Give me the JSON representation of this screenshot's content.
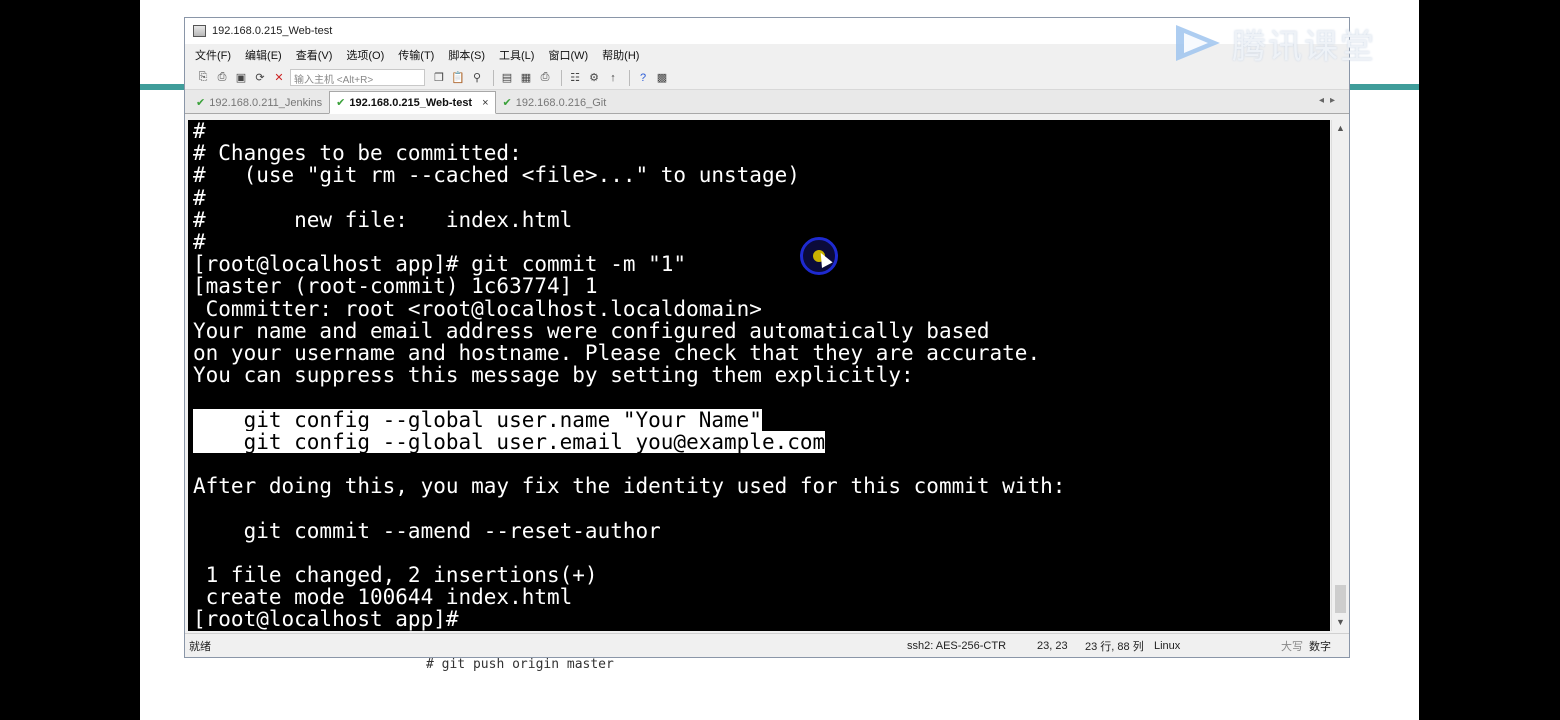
{
  "window": {
    "title": "192.168.0.215_Web-test"
  },
  "menu": [
    "文件(F)",
    "编辑(E)",
    "查看(V)",
    "选项(O)",
    "传输(T)",
    "脚本(S)",
    "工具(L)",
    "窗口(W)",
    "帮助(H)"
  ],
  "toolbar": {
    "host_placeholder": "输入主机 <Alt+R>"
  },
  "tabs": [
    {
      "label": "192.168.0.211_Jenkins",
      "active": false
    },
    {
      "label": "192.168.0.215_Web-test",
      "active": true,
      "close": "×"
    },
    {
      "label": "192.168.0.216_Git",
      "active": false
    }
  ],
  "terminal": {
    "lines": [
      {
        "text": "#",
        "highlight": false
      },
      {
        "text": "# Changes to be committed:",
        "highlight": false
      },
      {
        "text": "#   (use \"git rm --cached <file>...\" to unstage)",
        "highlight": false
      },
      {
        "text": "#",
        "highlight": false
      },
      {
        "text": "#       new file:   index.html",
        "highlight": false
      },
      {
        "text": "#",
        "highlight": false
      },
      {
        "text": "[root@localhost app]# git commit -m \"1\"",
        "highlight": false
      },
      {
        "text": "[master (root-commit) 1c63774] 1",
        "highlight": false
      },
      {
        "text": " Committer: root <root@localhost.localdomain>",
        "highlight": false
      },
      {
        "text": "Your name and email address were configured automatically based",
        "highlight": false
      },
      {
        "text": "on your username and hostname. Please check that they are accurate.",
        "highlight": false
      },
      {
        "text": "You can suppress this message by setting them explicitly:",
        "highlight": false
      },
      {
        "text": "",
        "highlight": false
      },
      {
        "text": "    git config --global user.name \"Your Name\"",
        "highlight": true
      },
      {
        "text": "    git config --global user.email you@example.com",
        "highlight": true
      },
      {
        "text": "",
        "highlight": false
      },
      {
        "text": "After doing this, you may fix the identity used for this commit with:",
        "highlight": false
      },
      {
        "text": "",
        "highlight": false
      },
      {
        "text": "    git commit --amend --reset-author",
        "highlight": false
      },
      {
        "text": "",
        "highlight": false
      },
      {
        "text": " 1 file changed, 2 insertions(+)",
        "highlight": false
      },
      {
        "text": " create mode 100644 index.html",
        "highlight": false
      },
      {
        "text": "[root@localhost app]#",
        "highlight": false
      }
    ]
  },
  "statusbar": {
    "ready": "就绪",
    "cipher": "ssh2: AES-256-CTR",
    "position": "23,  23",
    "rowcol": "23 行, 88 列",
    "os": "Linux",
    "caps": "大写",
    "num": "数字"
  },
  "background_text": "# git push origin master",
  "watermark": {
    "text": "腾讯课堂"
  },
  "colors": {
    "terminal_bg": "#000000",
    "terminal_fg": "#ffffff",
    "accent_teal": "#3f9d9a",
    "cursor_ring": "#1e2ad0"
  }
}
